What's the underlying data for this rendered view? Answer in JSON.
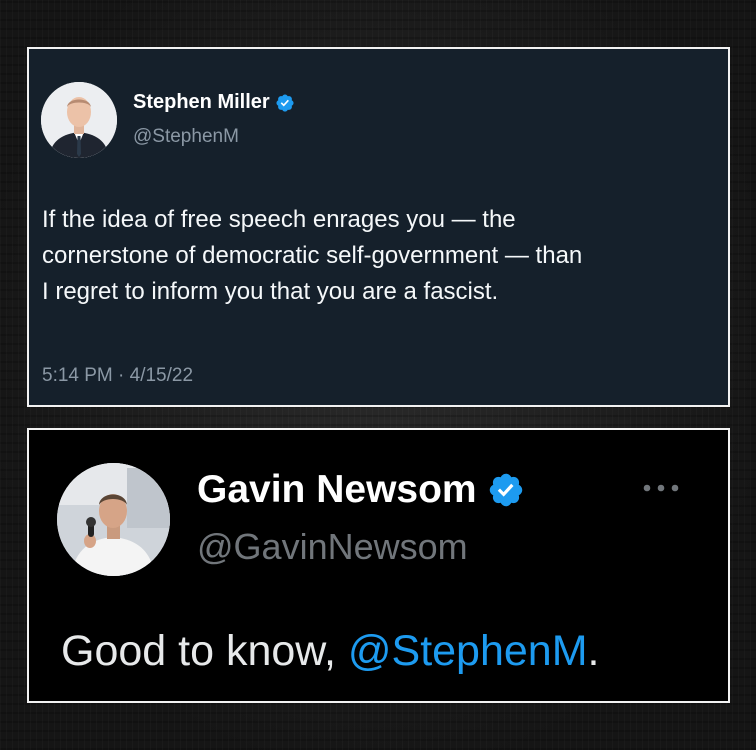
{
  "tweet1": {
    "name": "Stephen Miller",
    "handle": "@StephenM",
    "text_lines": [
      "If the idea of free speech enrages you — the",
      "cornerstone of democratic self-government — than",
      "I regret to inform you that you are a fascist."
    ],
    "timestamp": "5:14 PM · 4/15/22",
    "avatar_icon": "avatar-photo-icon",
    "verified_icon": "verified-badge-icon"
  },
  "tweet2": {
    "name": "Gavin Newsom",
    "handle": "@GavinNewsom",
    "text_prefix": "Good to know, ",
    "mention": "@StephenM",
    "text_suffix": ".",
    "avatar_icon": "avatar-photo-icon",
    "verified_icon": "verified-badge-icon",
    "more_icon": "more-options-icon"
  },
  "colors": {
    "tweet1_background": "#15202b",
    "tweet2_background": "#000000",
    "verified_blue": "#1d9bf0",
    "mention_blue": "#1d9bf0",
    "card_border": "#f2f2f2"
  }
}
